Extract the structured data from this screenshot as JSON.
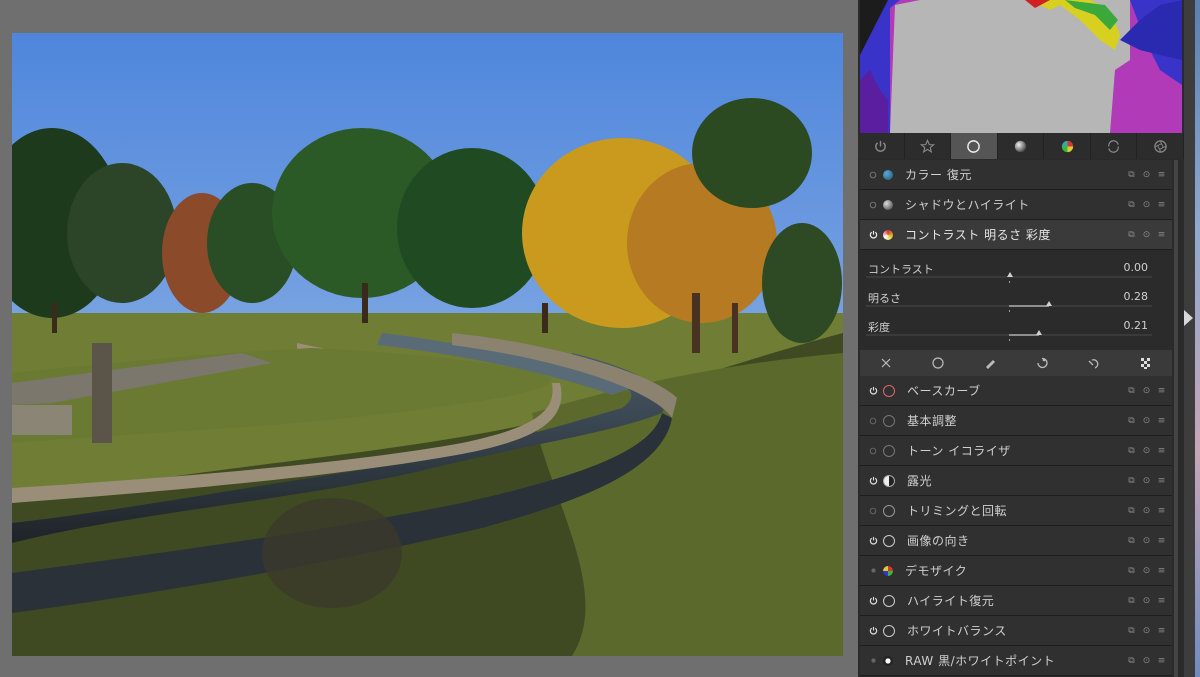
{
  "quick_tabs": [
    {
      "icon": "power-icon",
      "active": false
    },
    {
      "icon": "star-icon",
      "active": false
    },
    {
      "icon": "circle-icon",
      "active": true
    },
    {
      "icon": "sphere-icon",
      "active": false
    },
    {
      "icon": "color-circle-icon",
      "active": false
    },
    {
      "icon": "arrows-circle-icon",
      "active": false
    },
    {
      "icon": "aperture-icon",
      "active": false
    }
  ],
  "modules_top": [
    {
      "label": "カラー 復元",
      "icon": "color-restore-icon",
      "enabled": false
    },
    {
      "label": "シャドウとハイライト",
      "icon": "shadow-highlight-icon",
      "enabled": false
    },
    {
      "label": "コントラスト 明るさ 彩度",
      "icon": "contrast-icon",
      "enabled": true
    }
  ],
  "expanded_module": {
    "sliders": [
      {
        "label": "コントラスト",
        "value": "0.00",
        "position": 0.5
      },
      {
        "label": "明るさ",
        "value": "0.28",
        "position": 0.64
      },
      {
        "label": "彩度",
        "value": "0.21",
        "position": 0.6
      }
    ],
    "blend_icons": [
      "blend-off-icon",
      "blend-uniform-icon",
      "blend-drawn-icon",
      "blend-parametric-icon",
      "blend-drawn-parametric-icon",
      "blend-raster-icon"
    ]
  },
  "modules_bottom": [
    {
      "label": "ベースカーブ",
      "icon": "base-curve-icon",
      "enabled": true
    },
    {
      "label": "基本調整",
      "icon": "basic-adjust-icon",
      "enabled": false
    },
    {
      "label": "トーン イコライザ",
      "icon": "tone-equalizer-icon",
      "enabled": false
    },
    {
      "label": "露光",
      "icon": "exposure-icon",
      "enabled": true
    },
    {
      "label": "トリミングと回転",
      "icon": "crop-rotate-icon",
      "enabled": false
    },
    {
      "label": "画像の向き",
      "icon": "orientation-icon",
      "enabled": true
    },
    {
      "label": "デモザイク",
      "icon": "demosaic-icon",
      "enabled": true
    },
    {
      "label": "ハイライト復元",
      "icon": "highlight-restore-icon",
      "enabled": true
    },
    {
      "label": "ホワイトバランス",
      "icon": "white-balance-icon",
      "enabled": true
    },
    {
      "label": "RAW 黒/ホワイトポイント",
      "icon": "raw-point-icon",
      "enabled": true
    }
  ]
}
